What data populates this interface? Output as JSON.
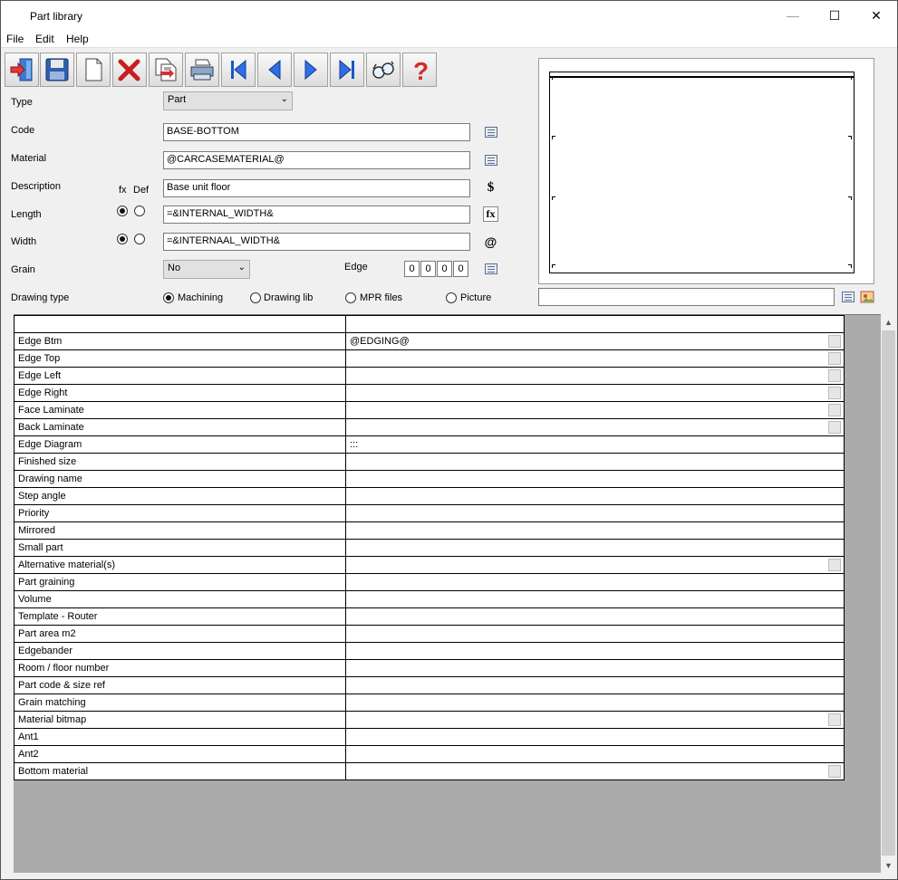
{
  "window": {
    "title": "Part library",
    "minimize": "—",
    "maximize": "☐",
    "close": "✕"
  },
  "menu": {
    "file": "File",
    "edit": "Edit",
    "help": "Help"
  },
  "toolbar": {
    "buttons": [
      "exit-icon",
      "save-icon",
      "new-icon",
      "delete-icon",
      "copy-icon",
      "print-icon",
      "first-record-icon",
      "previous-record-icon",
      "next-record-icon",
      "last-record-icon",
      "search-icon",
      "help-icon"
    ]
  },
  "form": {
    "type_label": "Type",
    "type_value": "Part",
    "code_label": "Code",
    "code_value": "BASE-BOTTOM",
    "material_label": "Material",
    "material_value": "@CARCASEMATERIAL@",
    "description_label": "Description",
    "description_value": "Base unit floor",
    "fx_label": "fx",
    "def_label": "Def",
    "length_label": "Length",
    "length_value": "=&INTERNAL_WIDTH&",
    "width_label": "Width",
    "width_value": "=&INTERNAAL_WIDTH&",
    "grain_label": "Grain",
    "grain_value": "No",
    "edge_label": "Edge",
    "edge_values": [
      "0",
      "0",
      "0",
      "0"
    ],
    "drawing_type_label": "Drawing type",
    "drawing_options": [
      "Machining",
      "Drawing lib",
      "MPR files",
      "Picture"
    ],
    "drawing_selected": "Machining",
    "dollar_icon": "$",
    "fx_icon": "fx",
    "at_icon": "@"
  },
  "preview": {
    "caption_value": ""
  },
  "grid": {
    "rows": [
      {
        "name": "Edge Btm",
        "value": "@EDGING@",
        "button": true
      },
      {
        "name": "Edge Top",
        "value": "",
        "button": true
      },
      {
        "name": "Edge Left",
        "value": "",
        "button": true
      },
      {
        "name": "Edge Right",
        "value": "",
        "button": true
      },
      {
        "name": "Face Laminate",
        "value": "",
        "button": true
      },
      {
        "name": "Back Laminate",
        "value": "",
        "button": true
      },
      {
        "name": "Edge Diagram",
        "value": ":::",
        "button": false
      },
      {
        "name": "Finished size",
        "value": "",
        "button": false
      },
      {
        "name": "Drawing name",
        "value": "",
        "button": false
      },
      {
        "name": "Step angle",
        "value": "",
        "button": false
      },
      {
        "name": "Priority",
        "value": "",
        "button": false
      },
      {
        "name": "Mirrored",
        "value": "",
        "button": false
      },
      {
        "name": "Small part",
        "value": "",
        "button": false
      },
      {
        "name": "Alternative material(s)",
        "value": "",
        "button": true
      },
      {
        "name": "Part graining",
        "value": "",
        "button": false
      },
      {
        "name": "Volume",
        "value": "",
        "button": false
      },
      {
        "name": "Template - Router",
        "value": "",
        "button": false
      },
      {
        "name": "Part area m2",
        "value": "",
        "button": false
      },
      {
        "name": "Edgebander",
        "value": "",
        "button": false
      },
      {
        "name": "Room / floor number",
        "value": "",
        "button": false
      },
      {
        "name": "Part code & size ref",
        "value": "",
        "button": false
      },
      {
        "name": "Grain matching",
        "value": "",
        "button": false
      },
      {
        "name": "Material bitmap",
        "value": "",
        "button": true
      },
      {
        "name": "Ant1",
        "value": "",
        "button": false
      },
      {
        "name": "Ant2",
        "value": "",
        "button": false
      },
      {
        "name": "Bottom material",
        "value": "",
        "button": true
      }
    ]
  }
}
